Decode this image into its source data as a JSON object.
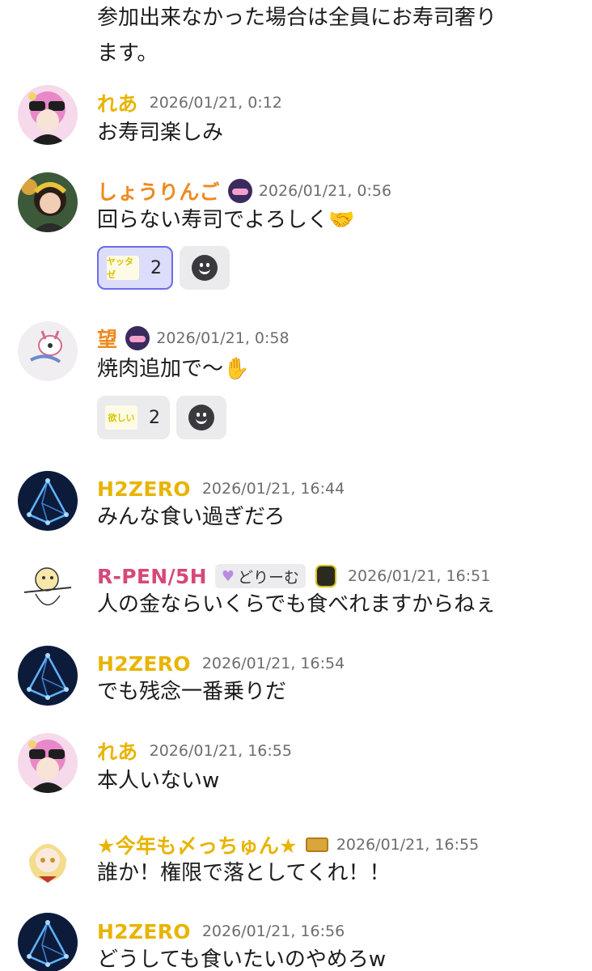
{
  "continuation": {
    "line1": "参加出来なかった場合は全員にお寿司奢り",
    "line2": "ます。"
  },
  "colors": {
    "yellow_name": "#e8b400",
    "orange_name": "#ee8a1e",
    "pink_name": "#d6487a",
    "timestamp": "#6d6d6d",
    "reaction_active_bg": "#dcdcfb",
    "reaction_active_border": "#6b6ce8"
  },
  "messages": [
    {
      "name": "れあ",
      "time": "2026/01/21, 0:12",
      "text": "お寿司楽しみ"
    },
    {
      "name": "しょうりんご",
      "time": "2026/01/21, 0:56",
      "text": "回らない寿司でよろしく🤝",
      "reactions": [
        {
          "icon": "custom-emoji-yellow-text",
          "count": "2",
          "active": true
        }
      ]
    },
    {
      "name": "望",
      "time": "2026/01/21, 0:58",
      "text": "焼肉追加で〜✋",
      "reactions": [
        {
          "icon": "custom-emoji-yellow-text",
          "count": "2",
          "active": false
        }
      ]
    },
    {
      "name": "H2ZERO",
      "time": "2026/01/21, 16:44",
      "text": "みんな食い過ぎだろ"
    },
    {
      "name": "R-PEN/5H",
      "role": "どりーむ",
      "time": "2026/01/21, 16:51",
      "text": "人の金ならいくらでも食べれますからねぇ"
    },
    {
      "name": "H2ZERO",
      "time": "2026/01/21, 16:54",
      "text": "でも残念一番乗りだ"
    },
    {
      "name": "れあ",
      "time": "2026/01/21, 16:55",
      "text": "本人いないw"
    },
    {
      "name": "★今年も〆っちゅん★",
      "time": "2026/01/21, 16:55",
      "text": "誰か！権限で落としてくれ！！"
    },
    {
      "name": "H2ZERO",
      "time": "2026/01/21, 16:56",
      "text": "どうしても食いたいのやめろw"
    }
  ]
}
